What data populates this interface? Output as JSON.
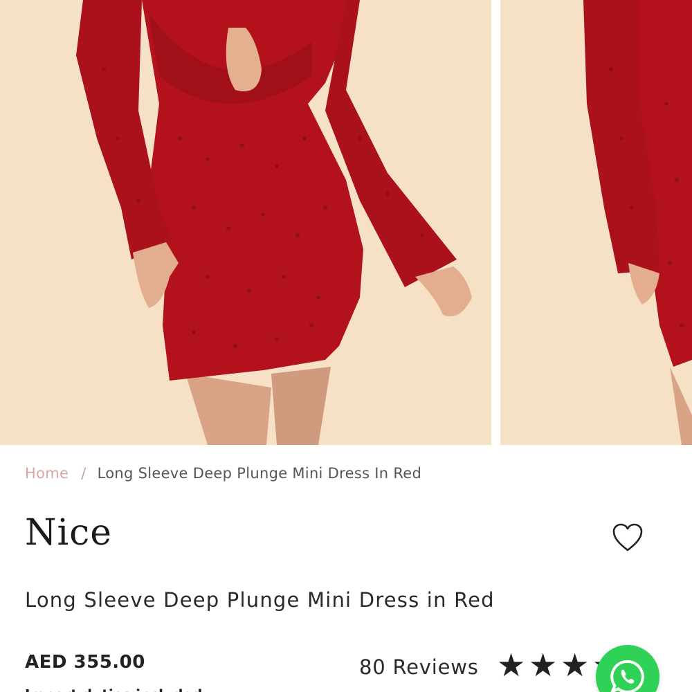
{
  "breadcrumb": {
    "home": "Home",
    "separator": "/",
    "current": "Long Sleeve Deep Plunge Mini Dress In Red"
  },
  "product": {
    "brand": "Nice",
    "title": "Long Sleeve Deep Plunge Mini Dress in Red",
    "price": "AED 355.00",
    "tax_note": "Import duties included",
    "reviews_label": "80 Reviews",
    "rating": 5
  },
  "icons": {
    "wishlist": "heart-icon",
    "star": "star-icon",
    "chat": "whatsapp-icon"
  },
  "colors": {
    "dress_red": "#b3121c",
    "backdrop": "#f5dfc4",
    "whatsapp_green": "#2fd156",
    "breadcrumb_home": "#d9a6a3"
  }
}
